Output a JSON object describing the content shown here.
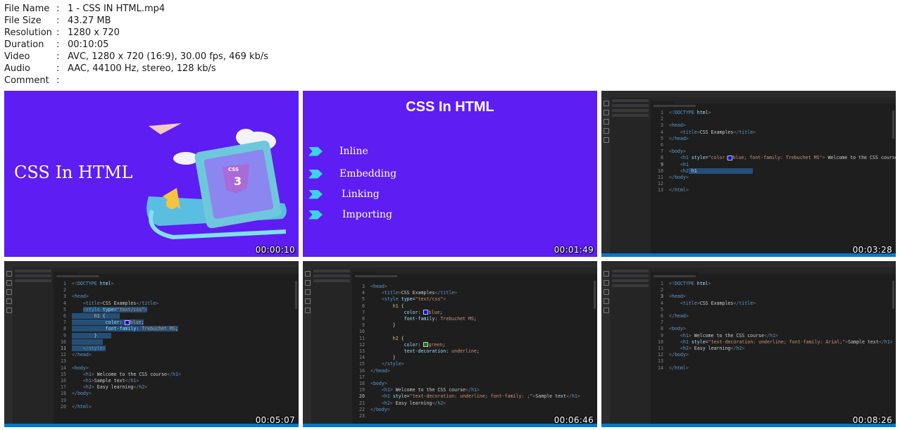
{
  "file_info": [
    {
      "label": "File Name",
      "value": "1 - CSS IN HTML.mp4"
    },
    {
      "label": "File Size",
      "value": "43.27 MB"
    },
    {
      "label": "Resolution",
      "value": "1280 x 720"
    },
    {
      "label": "Duration",
      "value": "00:10:05"
    },
    {
      "label": "Video",
      "value": "AVC, 1280 x 720 (16:9), 30.00 fps, 469 kb/s"
    },
    {
      "label": "Audio",
      "value": "AAC, 44100 Hz, stereo, 128 kb/s"
    },
    {
      "label": "Comment",
      "value": ""
    }
  ],
  "separator": ":",
  "thumbnails": [
    {
      "timestamp": "00:00:10",
      "title": "CSS In HTML",
      "badge": "CSS"
    },
    {
      "timestamp": "00:01:49",
      "title": "CSS In HTML",
      "bullets": [
        "Inline",
        "Embedding",
        "Linking",
        "Importing"
      ]
    },
    {
      "timestamp": "00:03:28"
    },
    {
      "timestamp": "00:05:07"
    },
    {
      "timestamp": "00:06:46"
    },
    {
      "timestamp": "00:08:26"
    }
  ],
  "colors": {
    "slide_bg": "#5e1df3",
    "bullet_arrow": "#3bd3e8",
    "editor_bg": "#1e1e1e",
    "status_bar": "#007acc"
  }
}
